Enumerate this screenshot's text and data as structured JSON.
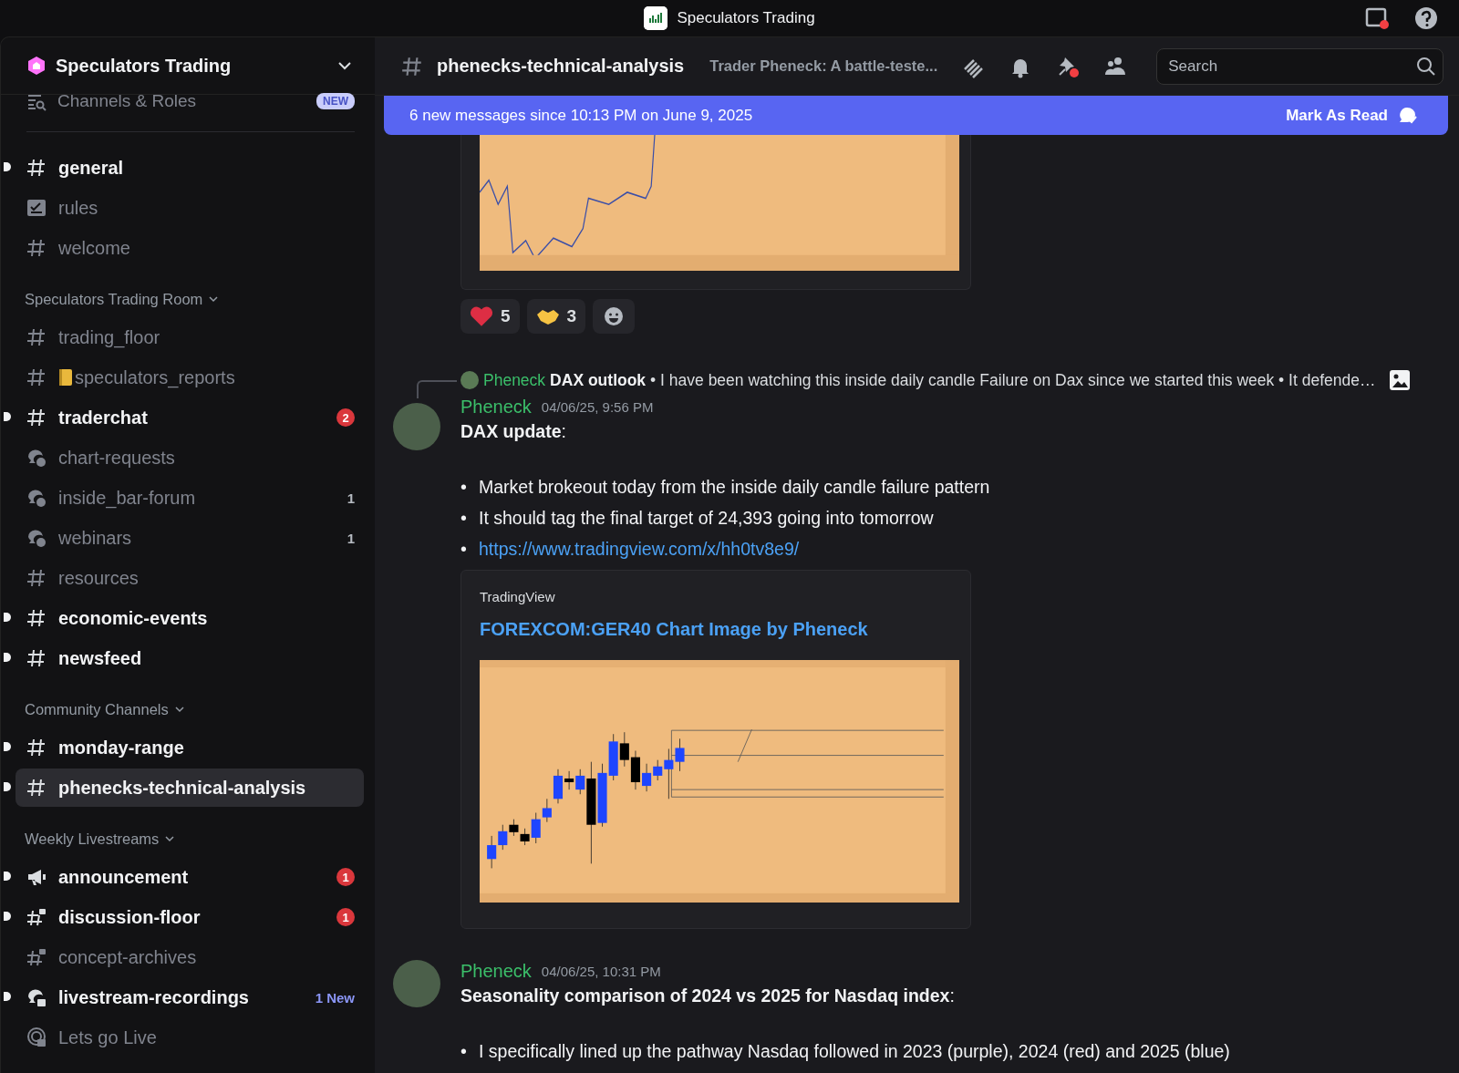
{
  "titlebar": {
    "title": "Speculators Trading"
  },
  "server": {
    "name": "Speculators Trading"
  },
  "sidebar": {
    "top_item": {
      "label": "Channels & Roles",
      "badge": "NEW"
    },
    "sections": [
      {
        "channels": [
          {
            "name": "general",
            "kind": "text",
            "unread": true,
            "selected": false
          },
          {
            "name": "rules",
            "kind": "rules",
            "unread": false,
            "selected": false
          },
          {
            "name": "welcome",
            "kind": "text",
            "unread": false,
            "selected": false
          }
        ]
      },
      {
        "title": "Speculators Trading Room",
        "channels": [
          {
            "name": "trading_floor",
            "kind": "text",
            "unread": false,
            "selected": false
          },
          {
            "name": "speculators_reports",
            "kind": "text",
            "unread": false,
            "selected": false,
            "emoji": true
          },
          {
            "name": "traderchat",
            "kind": "text",
            "unread": true,
            "selected": false,
            "badge": "2"
          },
          {
            "name": "chart-requests",
            "kind": "forum",
            "unread": false,
            "selected": false
          },
          {
            "name": "inside_bar-forum",
            "kind": "forum",
            "unread": false,
            "selected": false,
            "count": "1"
          },
          {
            "name": "webinars",
            "kind": "forum",
            "unread": false,
            "selected": false,
            "count": "1"
          },
          {
            "name": "resources",
            "kind": "text",
            "unread": false,
            "selected": false
          },
          {
            "name": "economic-events",
            "kind": "text",
            "unread": true,
            "selected": false
          },
          {
            "name": "newsfeed",
            "kind": "text",
            "unread": true,
            "selected": false
          }
        ]
      },
      {
        "title": "Community Channels",
        "channels": [
          {
            "name": "monday-range",
            "kind": "text",
            "unread": true,
            "selected": false
          },
          {
            "name": "phenecks-technical-analysis",
            "kind": "text",
            "unread": true,
            "selected": true
          }
        ]
      },
      {
        "title": "Weekly Livestreams",
        "channels": [
          {
            "name": "announcement",
            "kind": "announcement",
            "unread": true,
            "selected": false,
            "badge": "1"
          },
          {
            "name": "discussion-floor",
            "kind": "locked",
            "unread": true,
            "selected": false,
            "badge": "1"
          },
          {
            "name": "concept-archives",
            "kind": "locked",
            "unread": false,
            "selected": false
          },
          {
            "name": "livestream-recordings",
            "kind": "locked-forum",
            "unread": true,
            "selected": false,
            "new_label": "1 New"
          },
          {
            "name": "Lets go Live",
            "kind": "stage",
            "unread": false,
            "selected": false
          }
        ]
      }
    ]
  },
  "header": {
    "channel": "phenecks-technical-analysis",
    "topic": "Trader Pheneck: A battle-teste...",
    "search": {
      "placeholder": "Search"
    }
  },
  "banner": {
    "text": "6 new messages since 10:13 PM on June 9, 2025",
    "action": "Mark As Read"
  },
  "reactions": [
    {
      "kind": "heart",
      "count": "5"
    },
    {
      "kind": "handshake",
      "count": "3"
    }
  ],
  "messages": [
    {
      "reply": {
        "author": "Pheneck",
        "title": "DAX outlook",
        "snippet": "• I have been watching this inside daily candle Failure on Dax since we started this week  • It defende…"
      },
      "author": "Pheneck",
      "time": "04/06/25, 9:56 PM",
      "heading": "**DAX update**:",
      "bullets": [
        {
          "kind": "text",
          "marker": "•",
          "text": "Market brokeout today from the inside daily candle failure pattern"
        },
        {
          "kind": "text",
          "marker": "•",
          "text": "It should tag the final target of 24,393 going into tomorrow"
        },
        {
          "kind": "link",
          "marker": "•",
          "text": "https://www.tradingview.com/x/hh0tv8e9/"
        }
      ],
      "embed": {
        "provider": "TradingView",
        "title": "FOREXCOM:GER40 Chart Image by Pheneck"
      }
    },
    {
      "author": "Pheneck",
      "time": "04/06/25, 10:31 PM",
      "heading": "**Seasonality comparison of 2024 vs 2025 for Nasdaq index**:",
      "bullets": [
        {
          "kind": "text",
          "marker": "•",
          "text": "I specifically lined up the pathway Nasdaq followed in 2023 (purple), 2024 (red) and 2025 (blue)"
        }
      ]
    }
  ]
}
